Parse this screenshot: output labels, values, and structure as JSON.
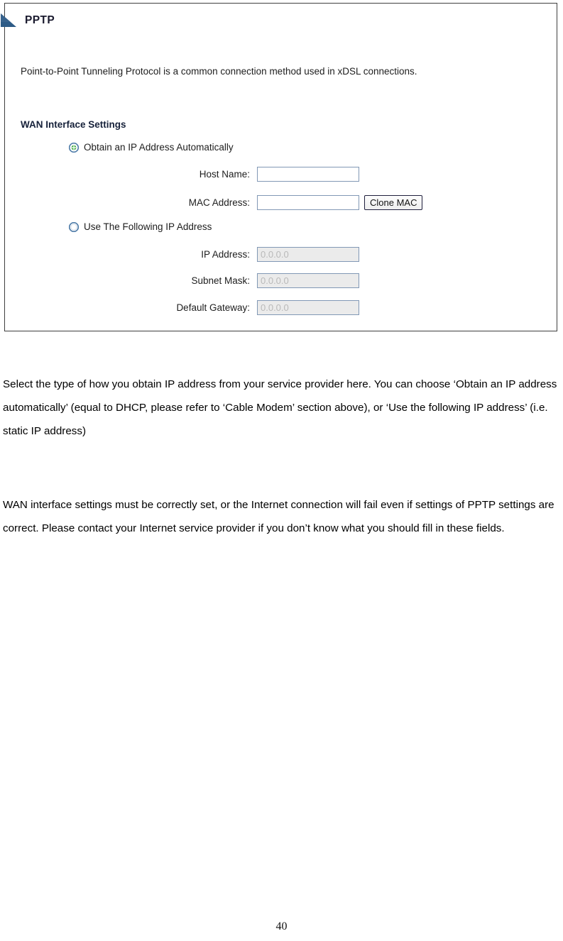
{
  "panel": {
    "icon": "blue-triangle-bullet-icon",
    "title": "PPTP",
    "description": "Point-to-Point Tunneling Protocol is a common connection method used in xDSL connections.",
    "section_title": "WAN Interface Settings",
    "options": [
      {
        "label": "Obtain an IP Address Automatically",
        "selected": true
      },
      {
        "label": "Use The Following IP Address",
        "selected": false
      }
    ],
    "fields": [
      {
        "label": "Host Name:",
        "value": "",
        "placeholder": "",
        "disabled": false,
        "button": null
      },
      {
        "label": "MAC Address:",
        "value": "",
        "placeholder": "",
        "disabled": false,
        "button": "Clone MAC"
      },
      {
        "label": "IP Address:",
        "value": "0.0.0.0",
        "placeholder": "",
        "disabled": true,
        "button": null
      },
      {
        "label": "Subnet Mask:",
        "value": "0.0.0.0",
        "placeholder": "",
        "disabled": true,
        "button": null
      },
      {
        "label": "Default Gateway:",
        "value": "0.0.0.0",
        "placeholder": "",
        "disabled": true,
        "button": null
      }
    ],
    "colors": {
      "panel_border": "#3f3f3f",
      "title_text": "#1a1a2e",
      "input_border": "#8198b5",
      "input_disabled_bg": "#ebebeb",
      "input_disabled_text": "#b9b9b9",
      "radio_ring": "#4d7ba8",
      "radio_selected_dot": "#3faa3f",
      "triangle_icon": "#2d5b86"
    }
  },
  "document": {
    "paragraph_1": "Select the type of how you obtain IP address from your service provider here. You can choose ‘Obtain an IP address automatically’ (equal to DHCP, please refer to ‘Cable Modem’ section above), or ‘Use the following IP address’ (i.e. static IP address)",
    "paragraph_2": "WAN interface settings must be correctly set, or the Internet connection will fail even if settings of PPTP settings are correct. Please contact your Internet service provider if you don’t know what you should fill in these fields.",
    "page_number": "40"
  }
}
